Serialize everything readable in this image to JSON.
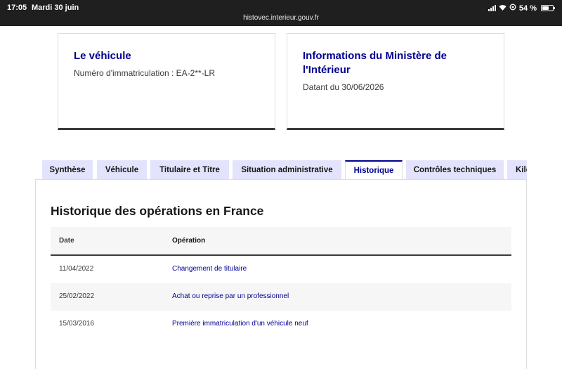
{
  "status_bar": {
    "time": "17:05",
    "date": "Mardi 30 juin",
    "battery": "54 %",
    "battery_level": 0.54
  },
  "url": "histovec.interieur.gouv.fr",
  "cards": [
    {
      "title": "Le véhicule",
      "text": "Numéro d'immatriculation : EA-2**-LR"
    },
    {
      "title": "Informations du Ministère de l'Intérieur",
      "text": "Datant du 30/06/2026"
    }
  ],
  "tabs": [
    {
      "label": "Synthèse",
      "active": false
    },
    {
      "label": "Véhicule",
      "active": false
    },
    {
      "label": "Titulaire et Titre",
      "active": false
    },
    {
      "label": "Situation administrative",
      "active": false
    },
    {
      "label": "Historique",
      "active": true
    },
    {
      "label": "Contrôles techniques",
      "active": false
    },
    {
      "label": "Kilo",
      "active": false
    }
  ],
  "history": {
    "title": "Historique des opérations en France",
    "columns": [
      "Date",
      "Opération"
    ],
    "rows": [
      {
        "date": "11/04/2022",
        "operation": "Changement de titulaire"
      },
      {
        "date": "25/02/2022",
        "operation": "Achat ou reprise par un professionnel"
      },
      {
        "date": "15/03/2016",
        "operation": "Première immatriculation d'un véhicule neuf"
      }
    ]
  },
  "colors": {
    "primary": "#000091",
    "tab_bg": "#e3e3fd",
    "row_alt": "#f6f6f6"
  }
}
